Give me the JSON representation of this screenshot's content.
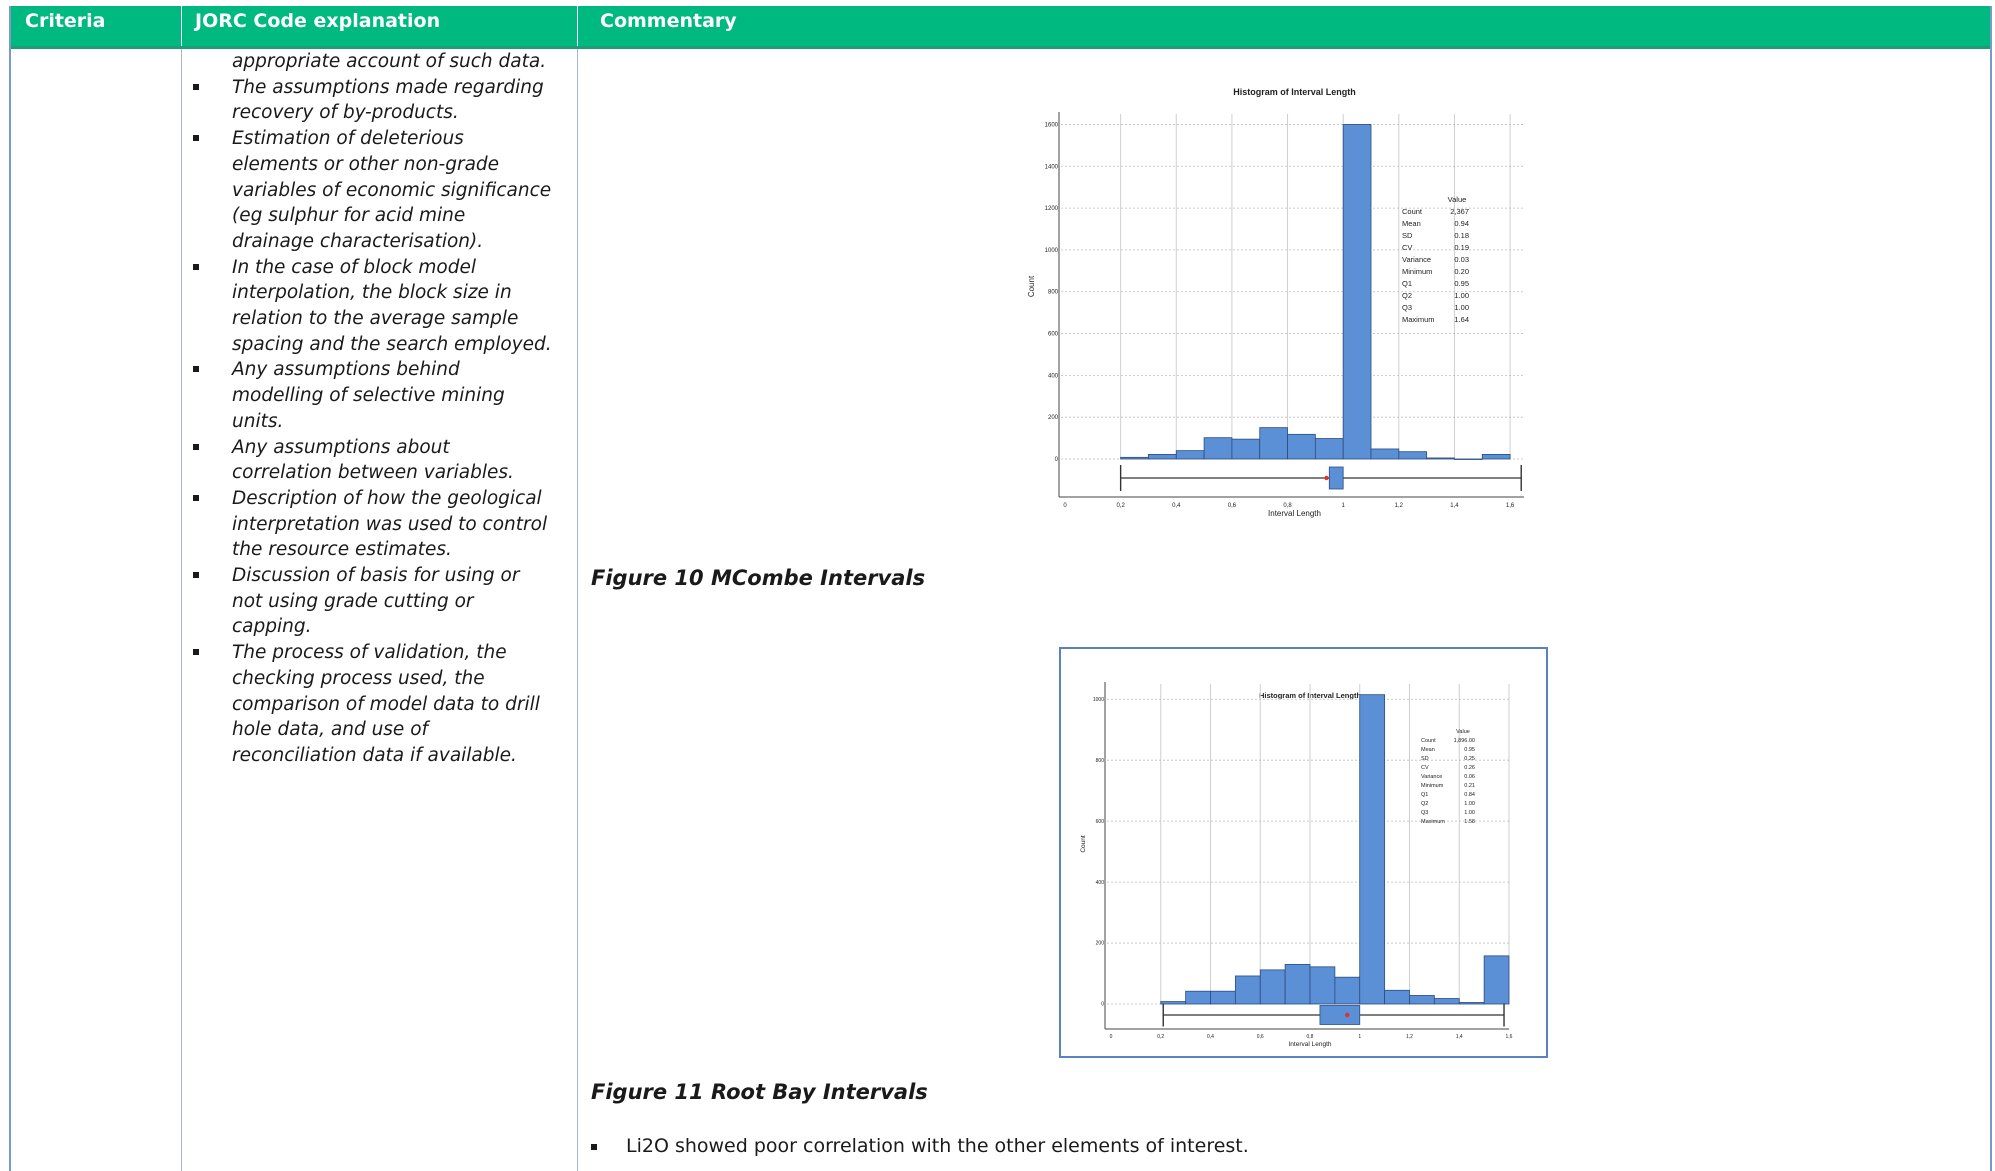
{
  "table": {
    "headers": [
      "Criteria",
      "JORC Code explanation",
      "Commentary"
    ]
  },
  "jorc_bullets": [
    {
      "text": "appropriate account of such data.",
      "continuation": true
    },
    {
      "text": "The assumptions made regarding recovery of by-products.",
      "continuation": false
    },
    {
      "text": "Estimation of deleterious elements or other non-grade variables of economic significance (eg sulphur for acid mine drainage characterisation).",
      "continuation": false
    },
    {
      "text": "In the case of block model interpolation, the block size in relation to the average sample spacing and the search employed.",
      "continuation": false
    },
    {
      "text": "Any assumptions behind modelling of selective mining units.",
      "continuation": false
    },
    {
      "text": "Any assumptions about correlation between variables.",
      "continuation": false
    },
    {
      "text": "Description of how the geological interpretation was used to control the resource estimates.",
      "continuation": false
    },
    {
      "text": "Discussion of basis for using or not using grade cutting or capping.",
      "continuation": false
    },
    {
      "text": "The process of validation, the checking process used, the comparison of model data to drill hole data, and use of reconciliation data if available.",
      "continuation": false
    }
  ],
  "commentary": {
    "figure10_caption": "Figure 10 MCombe Intervals",
    "figure11_caption": "Figure 11 Root Bay Intervals",
    "bullet": "Li2O showed poor correlation with the other elements of interest."
  },
  "colors": {
    "header_bg": "#00b981",
    "bar": "#5b8fd6",
    "median_marker": "#e03030"
  },
  "chart_data": [
    {
      "type": "bar",
      "title": "Histogram of Interval Length",
      "xlabel": "Interval Length",
      "ylabel": "Count",
      "x_ticks": [
        "0",
        "0,2",
        "0,4",
        "0,6",
        "0,8",
        "1",
        "1,2",
        "1,4",
        "1,6"
      ],
      "y_ticks": [
        "0",
        "200",
        "400",
        "600",
        "800",
        "1000",
        "1200",
        "1400",
        "1600"
      ],
      "xlim": [
        0,
        1.65
      ],
      "ylim": [
        0,
        1650
      ],
      "bin_start": 0.2,
      "bin_width": 0.1,
      "values": [
        8,
        22,
        40,
        102,
        95,
        150,
        118,
        98,
        1600,
        48,
        35,
        5,
        0,
        22
      ],
      "stats_header": "Value",
      "stats": [
        [
          "Count",
          "2,367"
        ],
        [
          "Mean",
          "0.94"
        ],
        [
          "SD",
          "0.18"
        ],
        [
          "CV",
          "0.19"
        ],
        [
          "Variance",
          "0.03"
        ],
        [
          "Minimum",
          "0.20"
        ],
        [
          "Q1",
          "0.95"
        ],
        [
          "Q2",
          "1.00"
        ],
        [
          "Q3",
          "1.00"
        ],
        [
          "Maximum",
          "1.64"
        ]
      ],
      "boxplot": {
        "min": 0.2,
        "q1": 0.95,
        "median": 1.0,
        "q3": 1.0,
        "max": 1.64,
        "mean": 0.94
      }
    },
    {
      "type": "bar",
      "title": "Histogram of Interval Length",
      "xlabel": "Interval Length",
      "ylabel": "Count",
      "x_ticks": [
        "0",
        "0,2",
        "0,4",
        "0,6",
        "0,8",
        "1",
        "1,2",
        "1,4",
        "1,6"
      ],
      "y_ticks": [
        "0",
        "200",
        "400",
        "600",
        "800",
        "1000"
      ],
      "xlim": [
        0,
        1.6
      ],
      "ylim": [
        0,
        1050
      ],
      "bin_start": 0.2,
      "bin_width": 0.1,
      "values": [
        8,
        42,
        42,
        92,
        112,
        130,
        122,
        88,
        1015,
        45,
        28,
        18,
        5,
        158
      ],
      "stats_header": "Value",
      "stats": [
        [
          "Count",
          "1,896.00"
        ],
        [
          "Mean",
          "0.95"
        ],
        [
          "SD",
          "0.25"
        ],
        [
          "CV",
          "0.26"
        ],
        [
          "Variance",
          "0.06"
        ],
        [
          "Minimum",
          "0.21"
        ],
        [
          "Q1",
          "0.84"
        ],
        [
          "Q2",
          "1.00"
        ],
        [
          "Q3",
          "1.00"
        ],
        [
          "Maximum",
          "1.58"
        ]
      ],
      "boxplot": {
        "min": 0.21,
        "q1": 0.84,
        "median": 1.0,
        "q3": 1.0,
        "max": 1.58,
        "mean": 0.95
      }
    }
  ]
}
